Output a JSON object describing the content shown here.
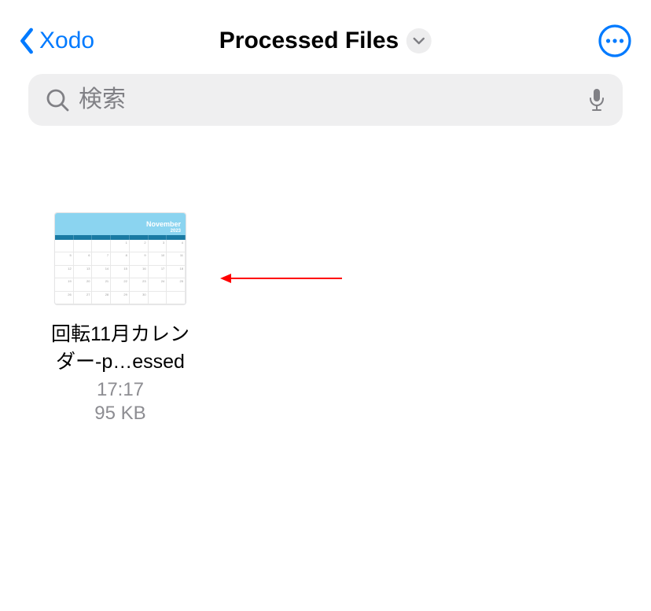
{
  "header": {
    "back_label": "Xodo",
    "title": "Processed Files"
  },
  "search": {
    "placeholder": "検索"
  },
  "thumbnail": {
    "month": "November",
    "year": "2023"
  },
  "files": [
    {
      "name_line1": "回転11月カレン",
      "name_line2": "ダー-p…essed",
      "time": "17:17",
      "size": "95 KB"
    }
  ]
}
